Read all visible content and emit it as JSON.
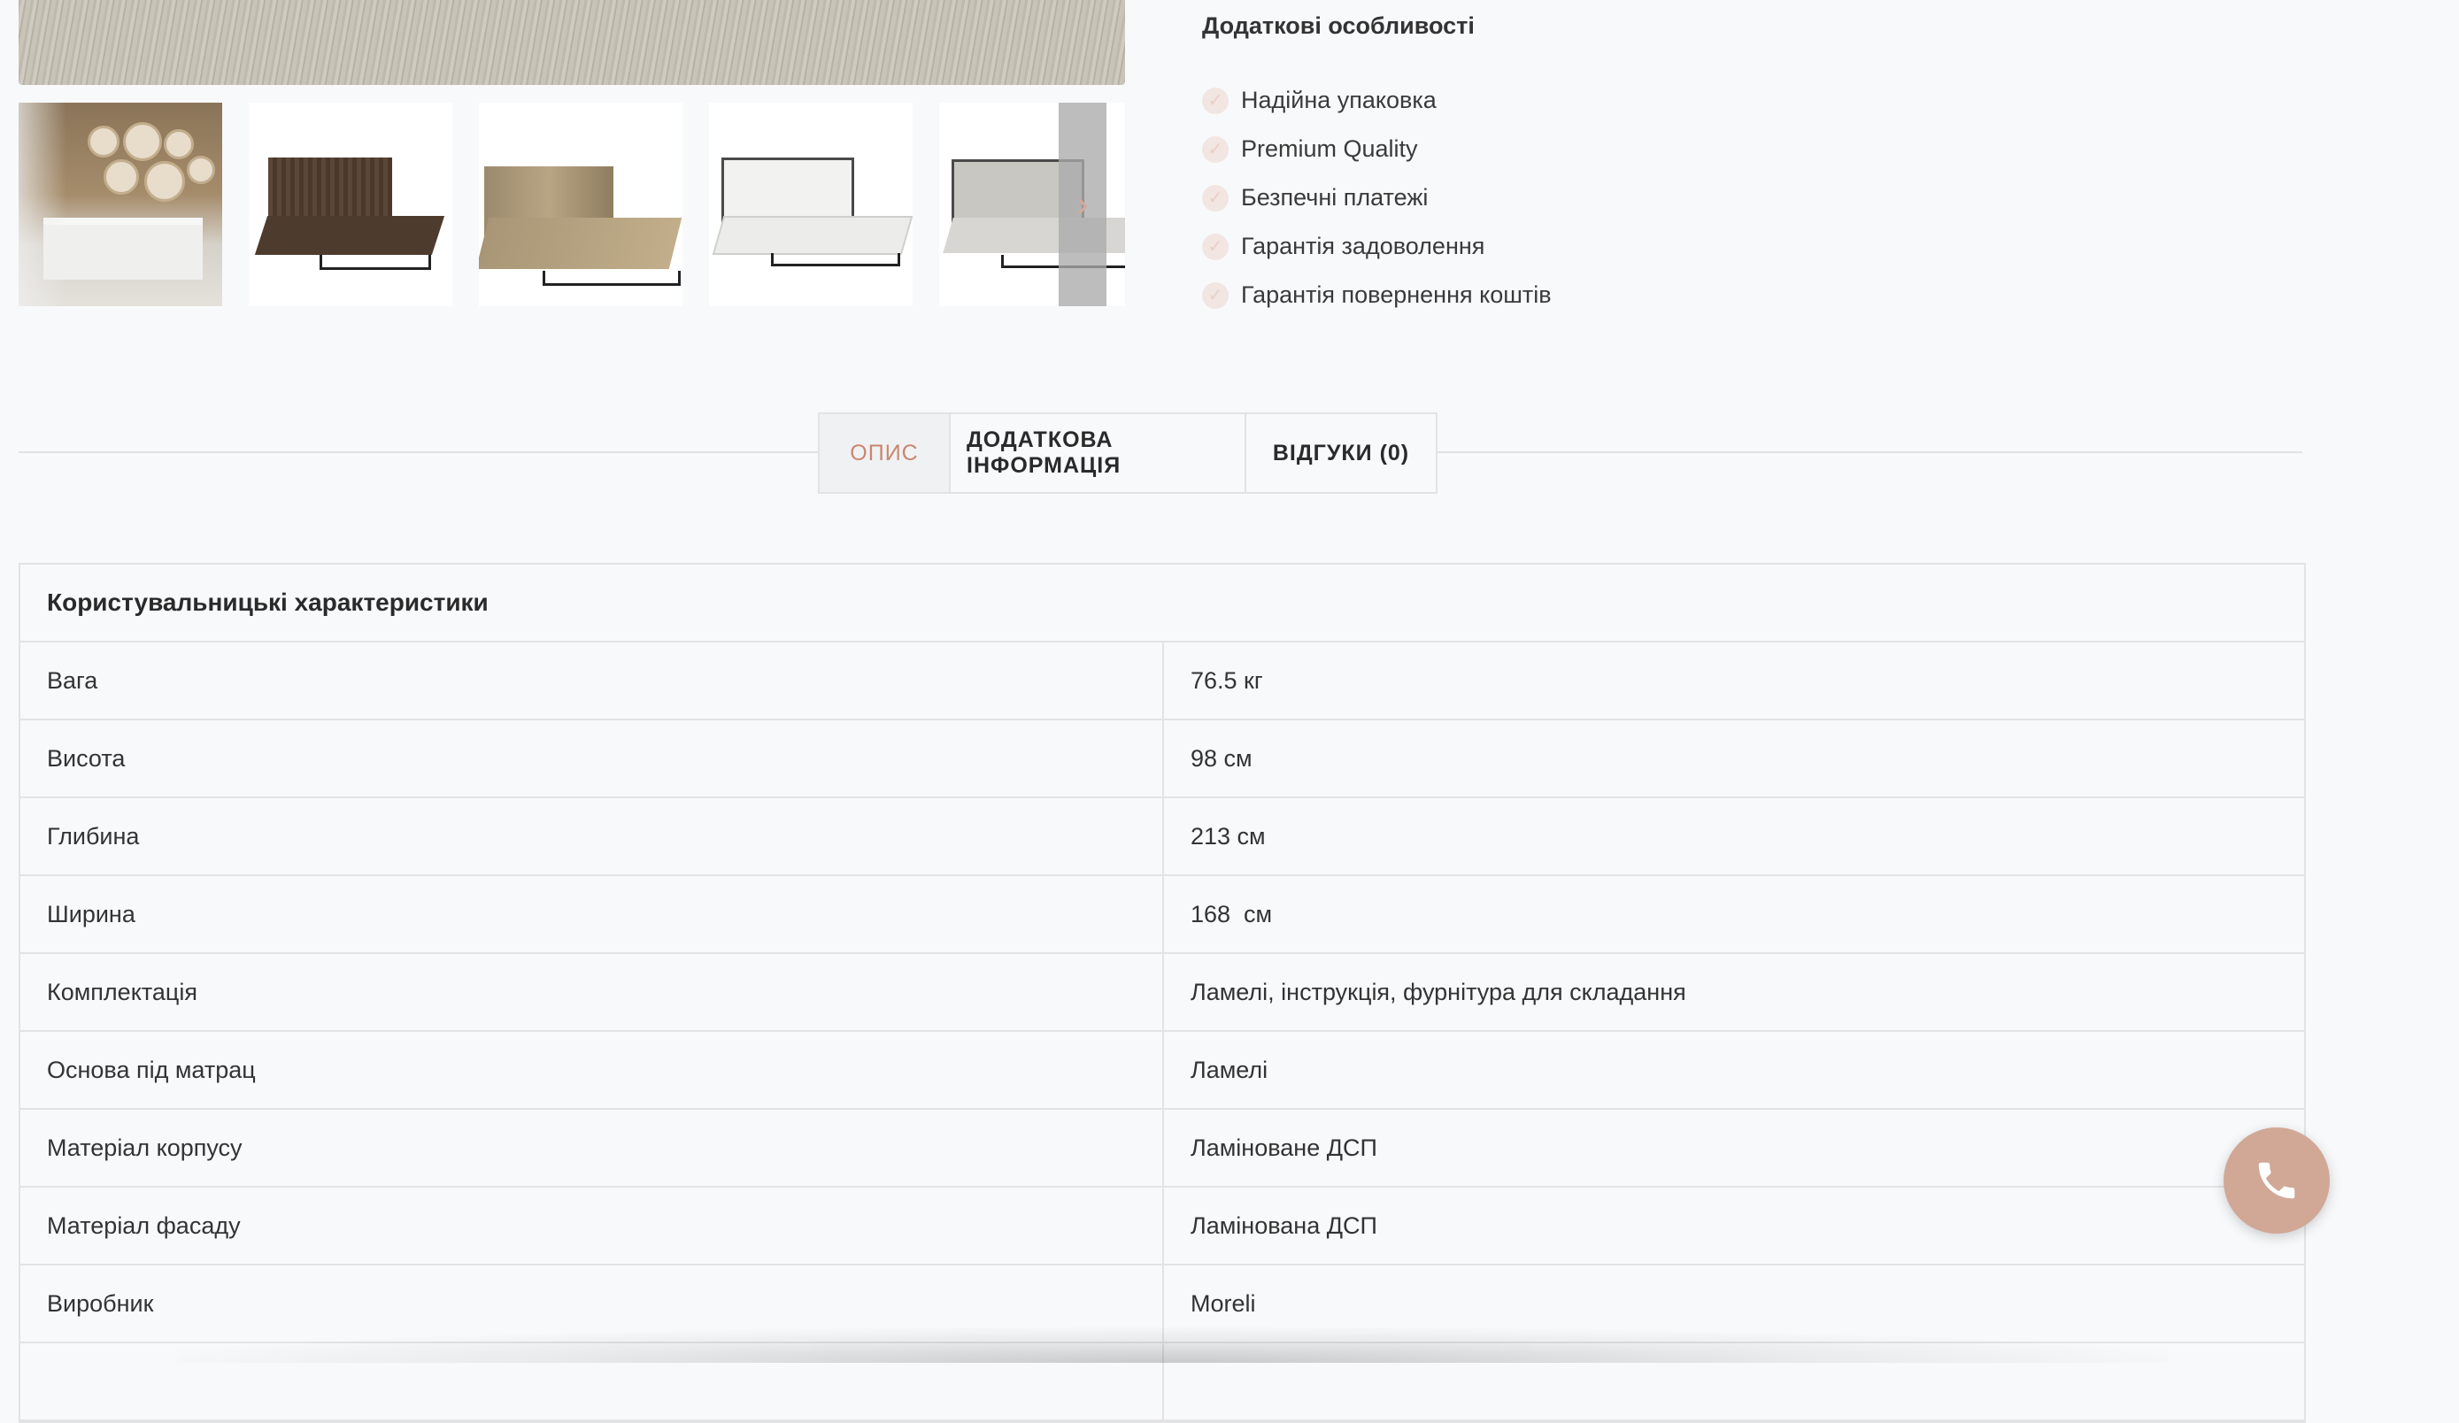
{
  "features": {
    "title": "Додаткові особливості",
    "items": [
      "Надійна упаковка",
      "Premium Quality",
      "Безпечні платежі",
      "Гарантія задоволення",
      "Гарантія повернення коштів"
    ]
  },
  "gallery": {
    "next_icon": "chevron-right-icon",
    "next_glyph": "›"
  },
  "tabs": [
    {
      "label": "ОПИС",
      "active": true
    },
    {
      "label": "ДОДАТКОВА ІНФОРМАЦІЯ",
      "active": false
    },
    {
      "label": "ВІДГУКИ (0)",
      "active": false
    }
  ],
  "spec": {
    "title": "Користувальницькі характеристики",
    "rows": [
      {
        "key": "Вага",
        "value": "76.5 кг"
      },
      {
        "key": "Висота",
        "value": "98 см"
      },
      {
        "key": "Глибина",
        "value": "213 см"
      },
      {
        "key": "Ширина",
        "value": "168  см"
      },
      {
        "key": "Комплектація",
        "value": "Ламелі, інструкція, фурнітура для складання"
      },
      {
        "key": "Основа під матрац",
        "value": "Ламелі"
      },
      {
        "key": "Матеріал корпусу",
        "value": "Ламіноване ДСП"
      },
      {
        "key": "Матеріал фасаду",
        "value": "Ламінована ДСП"
      },
      {
        "key": "Виробник",
        "value": "Moreli"
      }
    ]
  },
  "colors": {
    "accent": "#c9876e",
    "call_button": "#d1a896",
    "border": "#e3e3e5"
  },
  "call_button": {
    "icon": "phone-icon"
  }
}
